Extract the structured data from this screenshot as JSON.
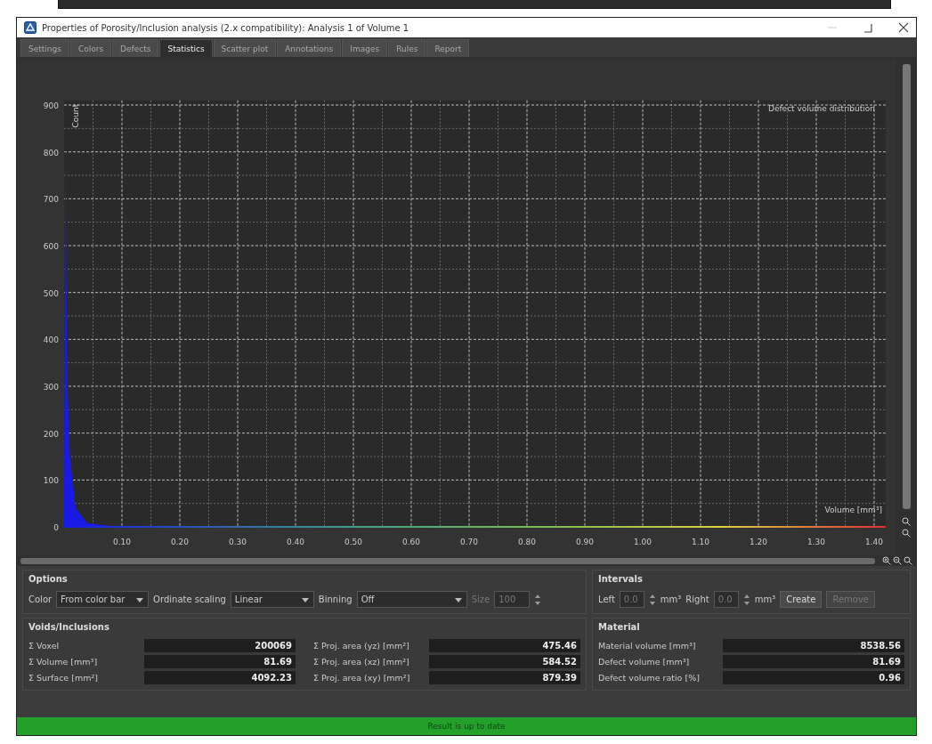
{
  "window": {
    "title": "Properties of Porosity/Inclusion analysis (2.x compatibility): Analysis 1 of Volume 1"
  },
  "tabs": [
    {
      "label": "Settings",
      "selected": false
    },
    {
      "label": "Colors",
      "selected": false
    },
    {
      "label": "Defects",
      "selected": false
    },
    {
      "label": "Statistics",
      "selected": true
    },
    {
      "label": "Scatter plot",
      "selected": false
    },
    {
      "label": "Annotations",
      "selected": false
    },
    {
      "label": "Images",
      "selected": false
    },
    {
      "label": "Rules",
      "selected": false
    },
    {
      "label": "Report",
      "selected": false
    }
  ],
  "chart": {
    "chart_data": {
      "type": "area",
      "title": "Defect volume distribution",
      "xlabel": "Volume [mm³]",
      "ylabel": "Count",
      "x": [
        0,
        0.002,
        0.005,
        0.01,
        0.02,
        0.04,
        0.08,
        0.2,
        1.42
      ],
      "grid": true,
      "series": [
        {
          "color": "#1a1ae6",
          "values": [
            20,
            870,
            330,
            150,
            40,
            8,
            2,
            1,
            0
          ]
        }
      ],
      "xlim": [
        0,
        1.42
      ],
      "ylim": [
        0,
        910
      ],
      "xticks": [
        {
          "value": 0.1,
          "label": "0.10"
        },
        {
          "value": 0.2,
          "label": "0.20"
        },
        {
          "value": 0.3,
          "label": "0.30"
        },
        {
          "value": 0.4,
          "label": "0.40"
        },
        {
          "value": 0.5,
          "label": "0.50"
        },
        {
          "value": 0.6,
          "label": "0.60"
        },
        {
          "value": 0.7,
          "label": "0.70"
        },
        {
          "value": 0.8,
          "label": "0.80"
        },
        {
          "value": 0.9,
          "label": "0.90"
        },
        {
          "value": 1.0,
          "label": "1.00"
        },
        {
          "value": 1.1,
          "label": "1.10"
        },
        {
          "value": 1.2,
          "label": "1.20"
        },
        {
          "value": 1.3,
          "label": "1.30"
        },
        {
          "value": 1.4,
          "label": "1.40"
        }
      ],
      "yticks": [
        0,
        100,
        200,
        300,
        400,
        500,
        600,
        700,
        800,
        900
      ]
    }
  },
  "options": {
    "title": "Options",
    "color": {
      "label": "Color",
      "value": "From color bar"
    },
    "ordinate_scaling": {
      "label": "Ordinate scaling",
      "value": "Linear"
    },
    "binning": {
      "label": "Binning",
      "value": "Off"
    },
    "size": {
      "label": "Size",
      "value": "100",
      "disabled": true
    }
  },
  "intervals": {
    "title": "Intervals",
    "fields": [
      {
        "label": "Left",
        "value": "0.0",
        "unit": "mm³",
        "disabled": true
      },
      {
        "label": "Right",
        "value": "0.0",
        "unit": "mm³",
        "disabled": true
      }
    ],
    "buttons": [
      {
        "label": "Create",
        "disabled": false
      },
      {
        "label": "Remove",
        "disabled": true
      }
    ]
  },
  "voids": {
    "title": "Voids/Inclusions",
    "fields": [
      {
        "label": "Σ Voxel",
        "value": "200069"
      },
      {
        "label": "Σ Volume [mm³]",
        "value": "81.69"
      },
      {
        "label": "Σ Surface [mm²]",
        "value": "4092.23"
      },
      {
        "label": "Σ Proj. area (yz) [mm²]",
        "value": "475.46"
      },
      {
        "label": "Σ Proj. area (xz) [mm²]",
        "value": "584.52"
      },
      {
        "label": "Σ Proj. area (xy) [mm²]",
        "value": "879.39"
      }
    ]
  },
  "material": {
    "title": "Material",
    "fields": [
      {
        "label": "Material volume [mm³]",
        "value": "8538.56"
      },
      {
        "label": "Defect volume [mm³]",
        "value": "81.69"
      },
      {
        "label": "Defect volume ratio [%]",
        "value": "0.96"
      }
    ]
  },
  "status_bar": {
    "text": "Result is up to date"
  }
}
